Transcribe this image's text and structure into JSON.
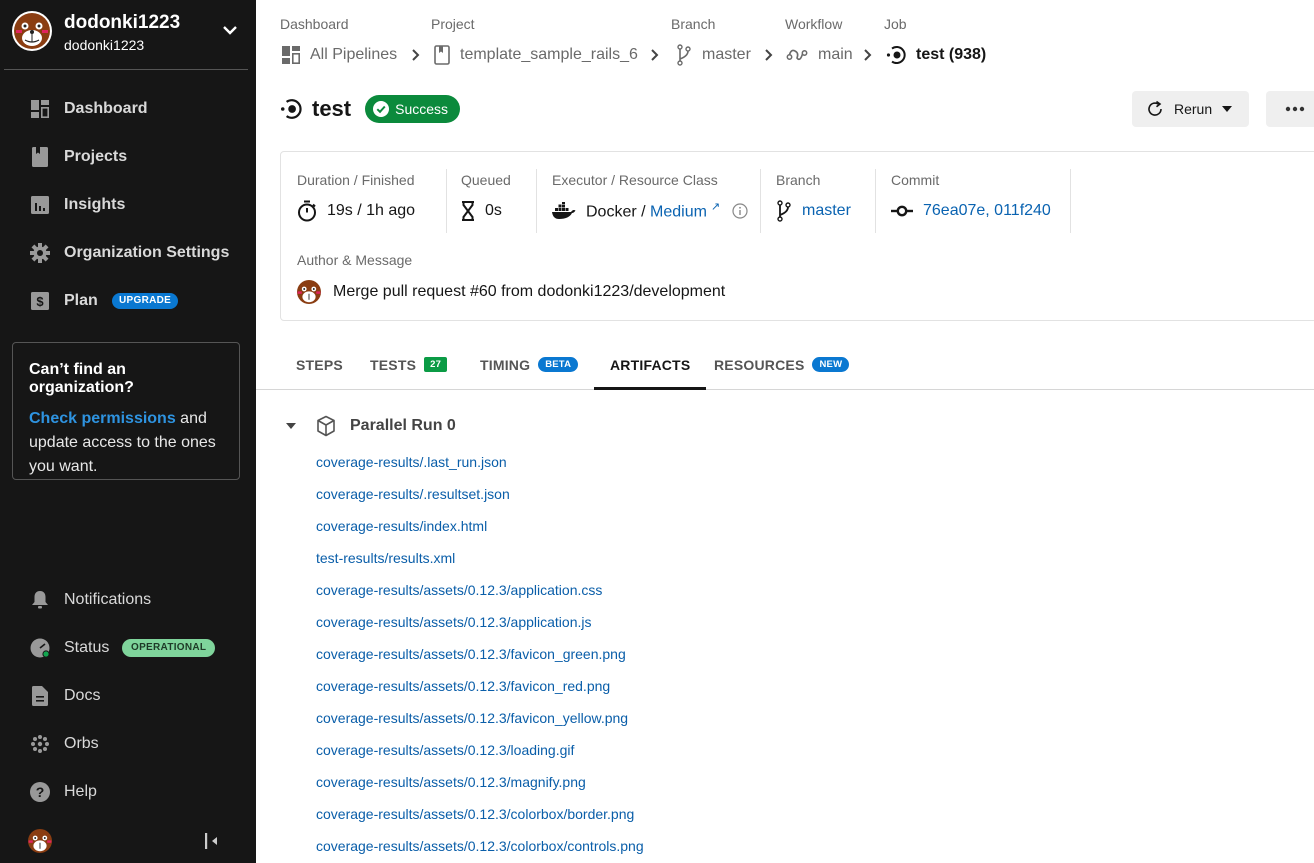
{
  "sidebar": {
    "user": {
      "name": "dodonki1223",
      "org": "dodonki1223"
    },
    "nav_top": [
      {
        "label": "Dashboard",
        "icon": "dashboard-icon"
      },
      {
        "label": "Projects",
        "icon": "projects-icon"
      },
      {
        "label": "Insights",
        "icon": "insights-icon"
      },
      {
        "label": "Organization Settings",
        "icon": "gear-icon"
      },
      {
        "label": "Plan",
        "icon": "dollar-icon",
        "badge": "UPGRADE"
      }
    ],
    "org_box": {
      "title": "Can’t find an organization?",
      "link": "Check permissions",
      "text": " and update access to the ones you want."
    },
    "nav_bottom": [
      {
        "label": "Notifications",
        "icon": "bell-icon"
      },
      {
        "label": "Status",
        "icon": "status-gauge-icon",
        "badge": "OPERATIONAL"
      },
      {
        "label": "Docs",
        "icon": "document-icon"
      },
      {
        "label": "Orbs",
        "icon": "orbs-icon"
      },
      {
        "label": "Help",
        "icon": "help-icon"
      }
    ]
  },
  "breadcrumbs": [
    {
      "label": "Dashboard",
      "value": "All Pipelines",
      "icon": "dashboard-icon"
    },
    {
      "label": "Project",
      "value": "template_sample_rails_6",
      "icon": "projects-icon"
    },
    {
      "label": "Branch",
      "value": "master",
      "icon": "branch-icon"
    },
    {
      "label": "Workflow",
      "value": "main",
      "icon": "workflow-icon"
    },
    {
      "label": "Job",
      "value": "test (938)",
      "icon": "job-icon"
    }
  ],
  "job": {
    "title": "test",
    "status": "Success",
    "status_color": "#0b8a3c",
    "rerun_label": "Rerun"
  },
  "summary": {
    "duration_label": "Duration / Finished",
    "duration_value": "19s / 1h ago",
    "queued_label": "Queued",
    "queued_value": "0s",
    "executor_label": "Executor / Resource Class",
    "executor_value": "Docker / ",
    "resource_class": "Medium",
    "branch_label": "Branch",
    "branch_value": "master",
    "commit_label": "Commit",
    "commit_value": "76ea07e, 011f240",
    "author_label": "Author & Message",
    "message": "Merge pull request #60 from dodonki1223/development"
  },
  "tabs": [
    {
      "label": "STEPS"
    },
    {
      "label": "TESTS",
      "badge": "27"
    },
    {
      "label": "TIMING",
      "badge": "BETA"
    },
    {
      "label": "ARTIFACTS",
      "active": true
    },
    {
      "label": "RESOURCES",
      "badge": "NEW"
    }
  ],
  "artifacts": {
    "group_title": "Parallel Run 0",
    "files": [
      "coverage-results/.last_run.json",
      "coverage-results/.resultset.json",
      "coverage-results/index.html",
      "test-results/results.xml",
      "coverage-results/assets/0.12.3/application.css",
      "coverage-results/assets/0.12.3/application.js",
      "coverage-results/assets/0.12.3/favicon_green.png",
      "coverage-results/assets/0.12.3/favicon_red.png",
      "coverage-results/assets/0.12.3/favicon_yellow.png",
      "coverage-results/assets/0.12.3/loading.gif",
      "coverage-results/assets/0.12.3/magnify.png",
      "coverage-results/assets/0.12.3/colorbox/border.png",
      "coverage-results/assets/0.12.3/colorbox/controls.png"
    ]
  }
}
